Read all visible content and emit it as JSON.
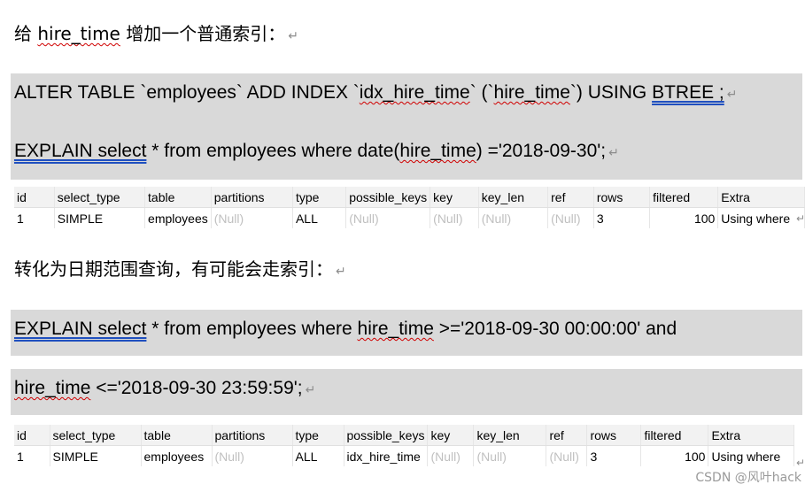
{
  "section1": {
    "heading_pre": "给 ",
    "heading_code": "hire_time",
    "heading_post": " 增加一个普通索引：",
    "para_mark": "↵"
  },
  "code1": {
    "line1": {
      "a": "ALTER TABLE `employees` ADD INDEX `",
      "b": "idx_hire_time",
      "c": "` (`",
      "d": "hire_time",
      "e": "`) USING ",
      "f": "BTREE ;"
    },
    "line2": {
      "a": "EXPLAIN  select",
      "b": " * from employees where date(",
      "c": "hire_time",
      "d": ") ='2018-09-30';"
    }
  },
  "table1": {
    "headers": [
      "id",
      "select_type",
      "table",
      "partitions",
      "type",
      "possible_keys",
      "key",
      "key_len",
      "ref",
      "rows",
      "filtered",
      "Extra"
    ],
    "row": [
      "1",
      "SIMPLE",
      "employees",
      "(Null)",
      "ALL",
      "(Null)",
      "(Null)",
      "(Null)",
      "(Null)",
      "3",
      "100",
      "Using where"
    ]
  },
  "section2": {
    "heading": "转化为日期范围查询，有可能会走索引："
  },
  "code2": {
    "line1": {
      "a": "EXPLAIN  select",
      "b": " * from employees where ",
      "c": "hire_time",
      "d": " >='2018-09-30 00:00:00'  and"
    },
    "line2": {
      "a": "hire_time",
      "b": " <='2018-09-30 23:59:59';"
    }
  },
  "table2": {
    "headers": [
      "id",
      "select_type",
      "table",
      "partitions",
      "type",
      "possible_keys",
      "key",
      "key_len",
      "ref",
      "rows",
      "filtered",
      "Extra"
    ],
    "row": [
      "1",
      "SIMPLE",
      "employees",
      "(Null)",
      "ALL",
      "idx_hire_time",
      "(Null)",
      "(Null)",
      "(Null)",
      "3",
      "100",
      "Using where"
    ]
  },
  "row_mark": "↵",
  "watermark": "CSDN @风叶hack"
}
